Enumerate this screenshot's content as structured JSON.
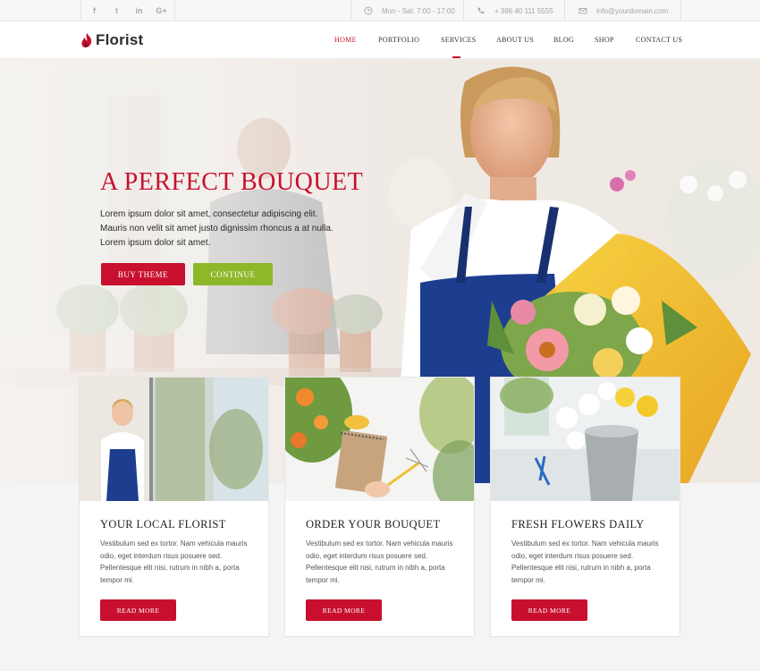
{
  "topbar": {
    "social": [
      {
        "icon": "facebook-icon",
        "glyph": "f"
      },
      {
        "icon": "twitter-icon",
        "glyph": "t"
      },
      {
        "icon": "linkedin-icon",
        "glyph": "in"
      },
      {
        "icon": "google-plus-icon",
        "glyph": "G+"
      }
    ],
    "hours": "Mon - Sat: 7:00 - 17:00",
    "phone": "+ 386 40 111 5555",
    "email": "info@yourdomain.com"
  },
  "header": {
    "logo_text": "Florist",
    "nav": [
      "HOME",
      "PORTFOLIO",
      "SERVICES",
      "ABOUT US",
      "BLOG",
      "SHOP",
      "CONTACT US"
    ],
    "active": "HOME"
  },
  "hero": {
    "title": "A PERFECT BOUQUET",
    "lines": [
      "Lorem ipsum dolor sit amet, consectetur adipiscing elit.",
      "Mauris non velit sit amet justo dignissim rhoncus a at nulla.",
      "Lorem ipsum dolor sit amet."
    ],
    "buy_label": "BUY THEME",
    "continue_label": "CONTINUE"
  },
  "cards": [
    {
      "title": "YOUR LOCAL FLORIST",
      "lines": [
        "Vestibulum sed ex tortor. Nam vehicula mauris",
        "odio, eget interdum risus posuere sed.",
        "Pellentesque elit nisi, rutrum in nibh a, porta",
        "tempor mi."
      ],
      "button": "READ MORE"
    },
    {
      "title": "ORDER YOUR BOUQUET",
      "lines": [
        "Vestibulum sed ex tortor. Nam vehicula mauris",
        "odio, eget interdum risus posuere sed.",
        "Pellentesque elit nisi, rutrum in nibh a, porta",
        "tempor mi."
      ],
      "button": "READ MORE"
    },
    {
      "title": "FRESH FLOWERS DAILY",
      "lines": [
        "Vestibulum sed ex tortor. Nam vehicula mauris",
        "odio, eget interdum risus posuere sed.",
        "Pellentesque elit nisi, rutrum in nibh a, porta",
        "tempor mi."
      ],
      "button": "READ MORE"
    }
  ],
  "colors": {
    "accent": "#c8102e",
    "green": "#8fb72a"
  }
}
